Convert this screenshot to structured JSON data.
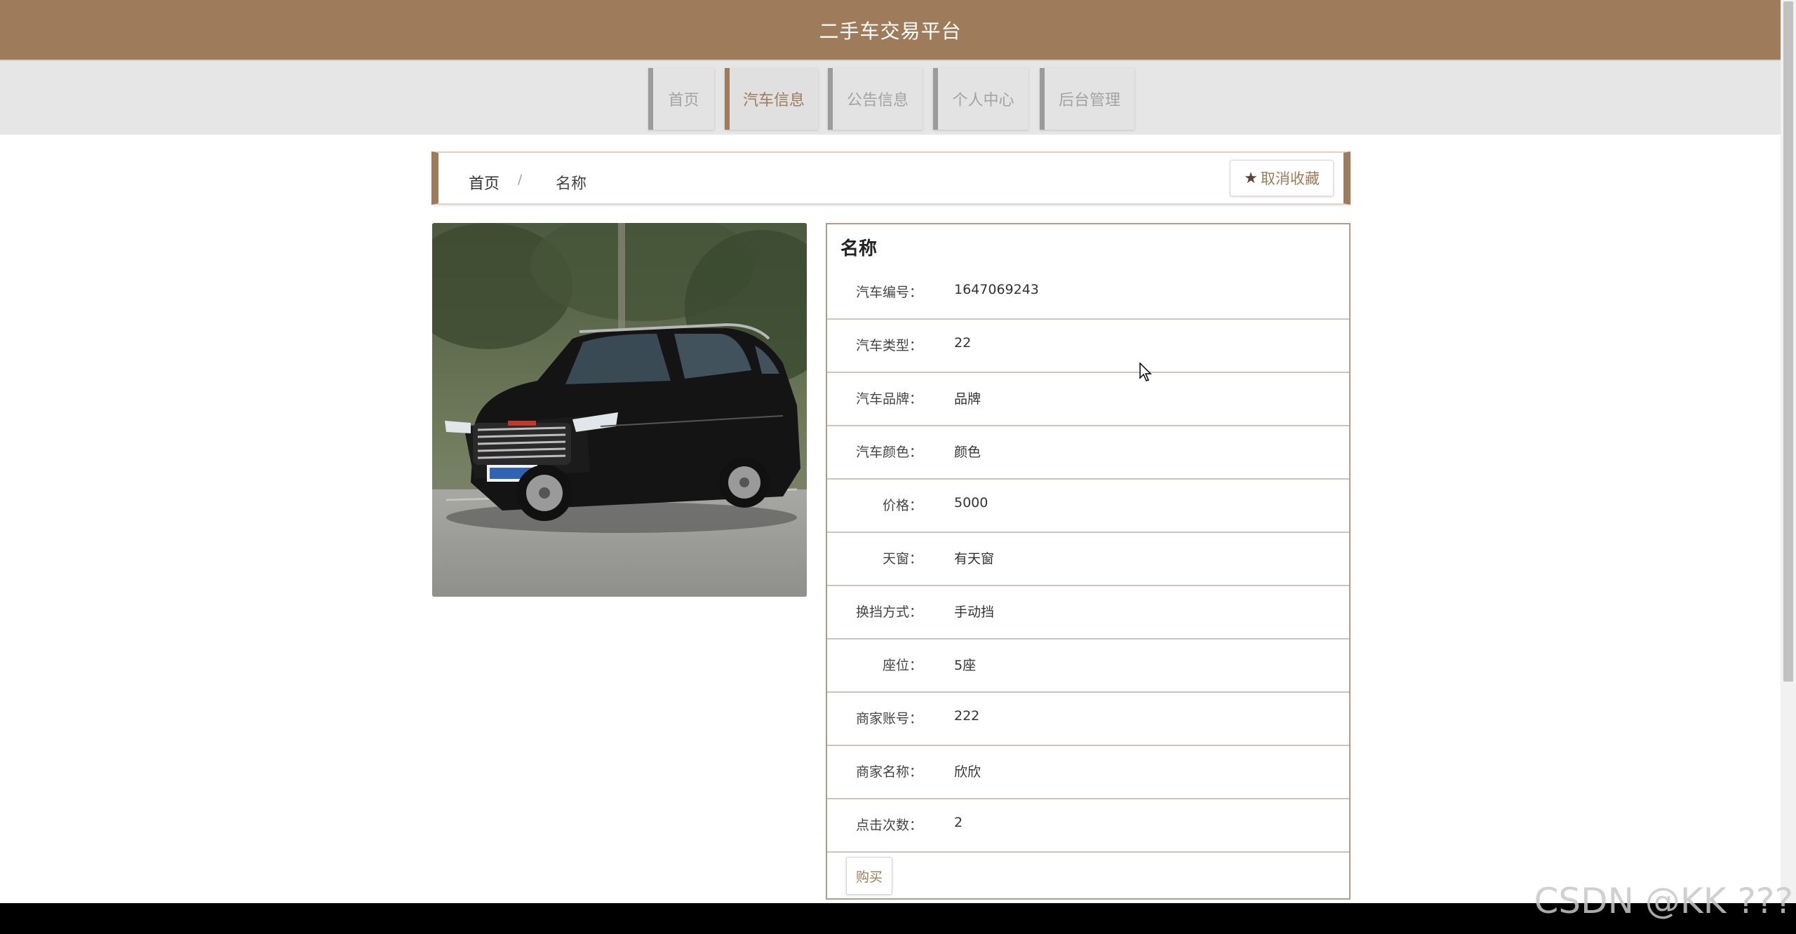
{
  "header": {
    "title": "二手车交易平台"
  },
  "nav": {
    "items": [
      {
        "label": "首页"
      },
      {
        "label": "汽车信息"
      },
      {
        "label": "公告信息"
      },
      {
        "label": "个人中心"
      },
      {
        "label": "后台管理"
      }
    ],
    "active_index": 1
  },
  "breadcrumb": {
    "home": "首页",
    "separator": "/",
    "current": "名称"
  },
  "favorite_button": {
    "icon": "star-icon",
    "label": "取消收藏"
  },
  "detail": {
    "title": "名称",
    "fields": [
      {
        "label": "汽车编号：",
        "value": "1647069243"
      },
      {
        "label": "汽车类型：",
        "value": "22"
      },
      {
        "label": "汽车品牌：",
        "value": "品牌"
      },
      {
        "label": "汽车颜色：",
        "value": "颜色"
      },
      {
        "label": "价格：",
        "value": "5000"
      },
      {
        "label": "天窗：",
        "value": "有天窗"
      },
      {
        "label": "换挡方式：",
        "value": "手动挡"
      },
      {
        "label": "座位：",
        "value": "5座"
      },
      {
        "label": "商家账号：",
        "value": "222"
      },
      {
        "label": "商家名称：",
        "value": "欣欣"
      },
      {
        "label": "点击次数：",
        "value": "2"
      }
    ],
    "buy_label": "购买"
  },
  "watermark": "CSDN @KK ???",
  "colors": {
    "brand": "#9e7b5a",
    "nav_bg": "#e6e6e6"
  }
}
